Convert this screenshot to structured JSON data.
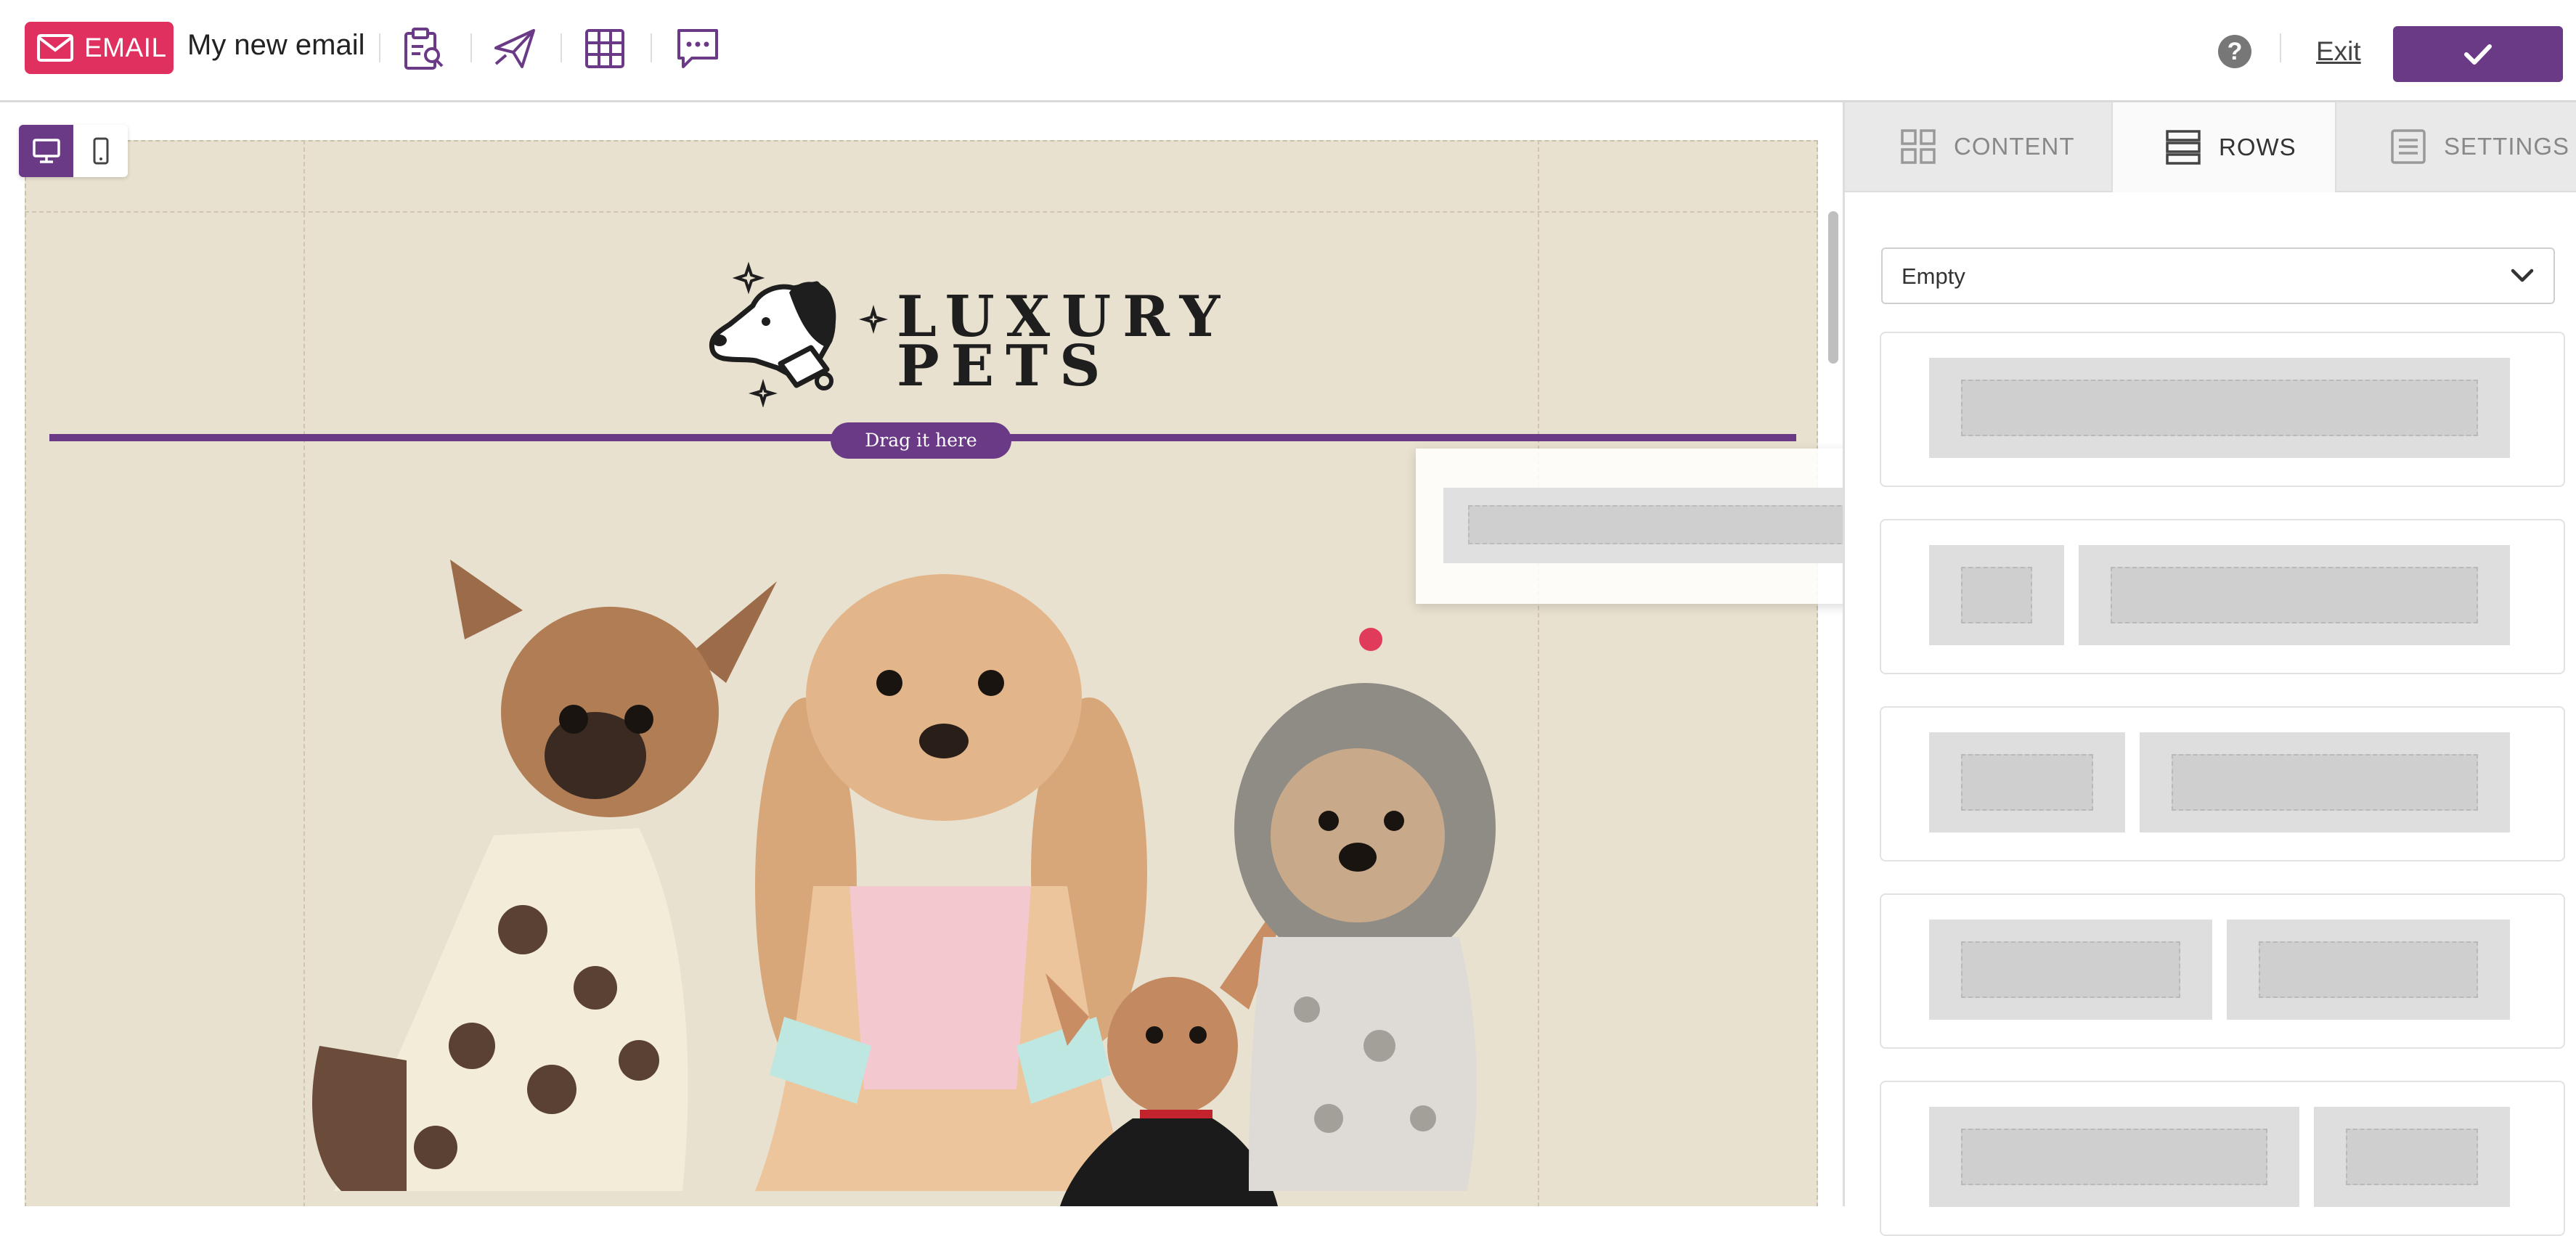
{
  "header": {
    "email_badge_label": "EMAIL",
    "email_name": "My new email",
    "tools": [
      "clipboard-icon",
      "send-icon",
      "grid-icon",
      "chat-icon"
    ],
    "help_label": "?",
    "exit_label": "Exit",
    "confirm_icon": "check-icon"
  },
  "colors": {
    "brand_purple": "#6a3a87",
    "email_badge": "#e0305f",
    "email_background": "#e9e1cf",
    "panel_tab_bg": "#e9e9e9"
  },
  "canvas": {
    "view_modes": [
      "desktop",
      "mobile"
    ],
    "active_view": "desktop",
    "logo_line1": "LUXURY",
    "logo_line2": "PETS",
    "drop_hint": "Drag it here"
  },
  "panel": {
    "tabs": [
      {
        "label": "CONTENT",
        "icon": "content-grid-icon",
        "active": false
      },
      {
        "label": "ROWS",
        "icon": "rows-icon",
        "active": true
      },
      {
        "label": "SETTINGS",
        "icon": "settings-icon",
        "active": false
      }
    ],
    "rows_filter": "Empty",
    "row_layouts": [
      "1 column",
      "1:4 columns",
      "1:2 columns",
      "1:1 columns",
      "2:1 columns"
    ]
  }
}
